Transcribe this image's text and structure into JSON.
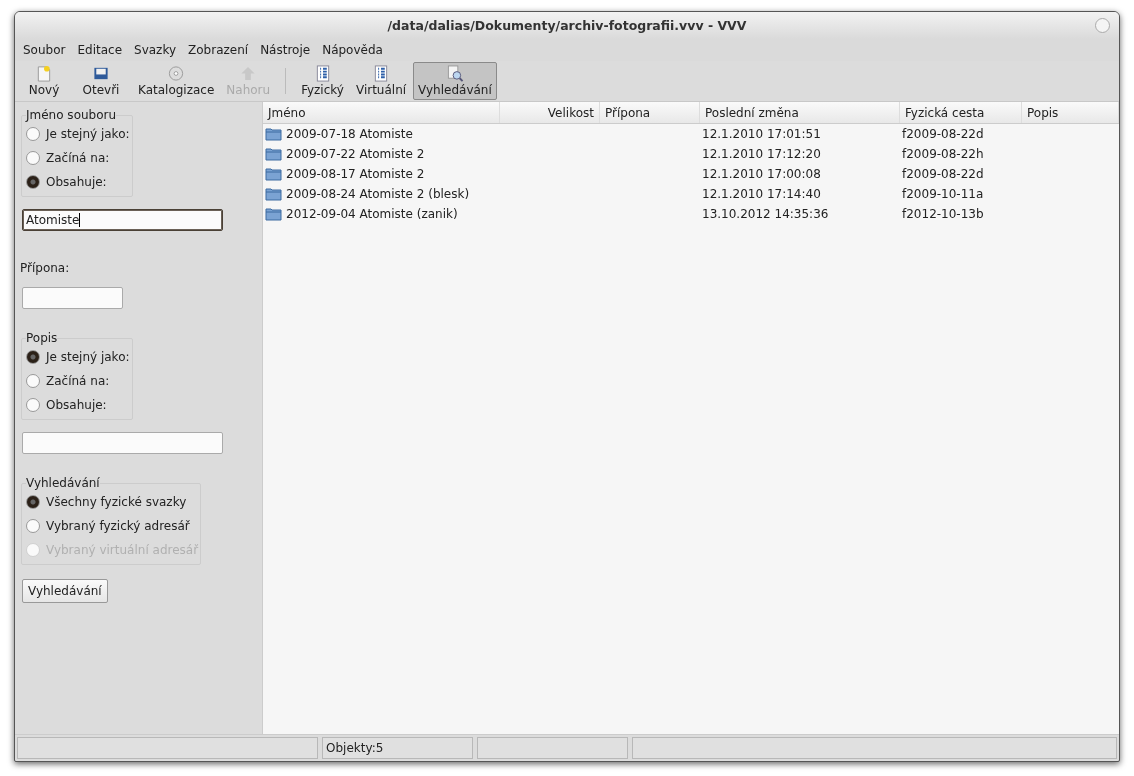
{
  "window": {
    "title": "/data/dalias/Dokumenty/archiv-fotografii.vvv - VVV"
  },
  "menu": [
    "Soubor",
    "Editace",
    "Svazky",
    "Zobrazení",
    "Nástroje",
    "Nápověda"
  ],
  "toolbar": [
    {
      "kind": "button",
      "label": "Nový",
      "disabled": false,
      "selected": false
    },
    {
      "kind": "button",
      "label": "Otevři",
      "disabled": false,
      "selected": false
    },
    {
      "kind": "button",
      "label": "Katalogizace",
      "disabled": false,
      "selected": false
    },
    {
      "kind": "button",
      "label": "Nahoru",
      "disabled": true,
      "selected": false
    },
    {
      "kind": "separator"
    },
    {
      "kind": "button",
      "label": "Fyzický",
      "disabled": false,
      "selected": false
    },
    {
      "kind": "button",
      "label": "Virtuální",
      "disabled": false,
      "selected": false
    },
    {
      "kind": "button",
      "label": "Vyhledávání",
      "disabled": false,
      "selected": true
    }
  ],
  "search_panel": [
    {
      "kind": "radio_group",
      "title": "Jméno souboru",
      "options": [
        {
          "label": "Je stejný jako:",
          "selected": false,
          "disabled": false
        },
        {
          "label": "Začíná na:",
          "selected": false,
          "disabled": false
        },
        {
          "label": "Obsahuje:",
          "selected": true,
          "disabled": false
        }
      ]
    },
    {
      "kind": "field",
      "value": "Atomiste",
      "focused": true,
      "wide": true
    },
    {
      "kind": "label",
      "text": "Přípona:"
    },
    {
      "kind": "field",
      "focused": false,
      "wide": false
    },
    {
      "kind": "radio_group",
      "title": "Popis",
      "options": [
        {
          "label": "Je stejný jako:",
          "selected": true,
          "disabled": false
        },
        {
          "label": "Začíná na:",
          "selected": false,
          "disabled": false
        },
        {
          "label": "Obsahuje:",
          "selected": false,
          "disabled": false
        }
      ]
    },
    {
      "kind": "field",
      "focused": false,
      "wide": true
    },
    {
      "kind": "radio_group",
      "title": "Vyhledávání",
      "options": [
        {
          "label": "Všechny fyzické svazky",
          "selected": true,
          "disabled": false
        },
        {
          "label": "Vybraný fyzický adresář",
          "selected": false,
          "disabled": false
        },
        {
          "label": "Vybraný virtuální adresář",
          "selected": false,
          "disabled": true
        }
      ]
    },
    {
      "kind": "button",
      "label": "Vyhledávání"
    }
  ],
  "table": {
    "columns": [
      "Jméno",
      "Velikost",
      "Přípona",
      "Poslední změna",
      "Fyzická cesta",
      "Popis"
    ],
    "rows": [
      [
        "2009-07-18 Atomiste",
        "",
        "",
        "12.1.2010 17:01:51",
        "f2009-08-22d",
        ""
      ],
      [
        "2009-07-22 Atomiste 2",
        "",
        "",
        "12.1.2010 17:12:20",
        "f2009-08-22h",
        ""
      ],
      [
        "2009-08-17 Atomiste 2",
        "",
        "",
        "12.1.2010 17:00:08",
        "f2009-08-22d",
        ""
      ],
      [
        "2009-08-24 Atomiste 2 (blesk)",
        "",
        "",
        "12.1.2010 17:14:40",
        "f2009-10-11a",
        ""
      ],
      [
        "2012-09-04 Atomiste (zanik)",
        "",
        "",
        "13.10.2012 14:35:36",
        "f2012-10-13b",
        ""
      ]
    ]
  },
  "status_bar": [
    {
      "kind": "panel"
    },
    {
      "kind": "panel",
      "text": "Objekty:5"
    },
    {
      "kind": "panel"
    },
    {
      "kind": "panel"
    }
  ]
}
